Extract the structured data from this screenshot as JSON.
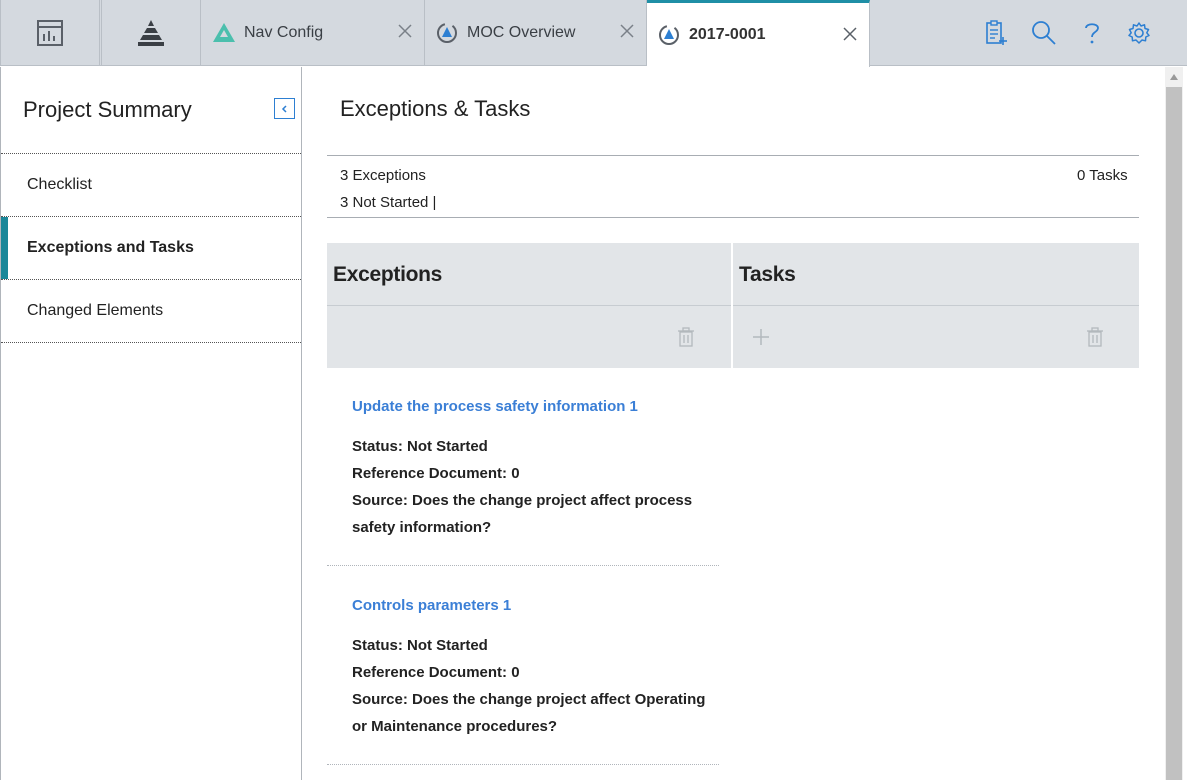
{
  "tabs": {
    "app_icons": [
      "dashboard-icon",
      "pyramid-icon"
    ],
    "items": [
      {
        "label": "Nav Config",
        "icon": "nav-config-icon"
      },
      {
        "label": "MOC Overview",
        "icon": "moc-icon"
      },
      {
        "label": "2017-0001",
        "icon": "moc-icon",
        "active": true
      }
    ]
  },
  "toolbar": {
    "icons": [
      "new-record-icon",
      "search-icon",
      "help-icon",
      "settings-icon"
    ]
  },
  "sidebar": {
    "title": "Project Summary",
    "items": [
      {
        "label": "Checklist"
      },
      {
        "label": "Exceptions and Tasks",
        "active": true
      },
      {
        "label": "Changed Elements"
      }
    ]
  },
  "main": {
    "title": "Exceptions & Tasks",
    "summary": {
      "exceptions_count": "3 Exceptions",
      "not_started": "3 Not Started |",
      "tasks_count": "0 Tasks"
    },
    "columns": {
      "exceptions": "Exceptions",
      "tasks": "Tasks"
    },
    "exceptions": [
      {
        "title": "Update the process safety information 1",
        "status": "Status: Not Started",
        "reference": "Reference Document: 0",
        "source_line1": "Source: Does the change project affect process",
        "source_line2": "safety information?"
      },
      {
        "title": "Controls parameters 1",
        "status": "Status: Not Started",
        "reference": "Reference Document: 0",
        "source_line1": "Source: Does the change project affect Operating",
        "source_line2": "or Maintenance procedures?"
      }
    ]
  },
  "colors": {
    "accent": "#1b8799",
    "link": "#3b7fd6",
    "tab_bar": "#d4d9df",
    "grid_header": "#e2e5e8"
  }
}
